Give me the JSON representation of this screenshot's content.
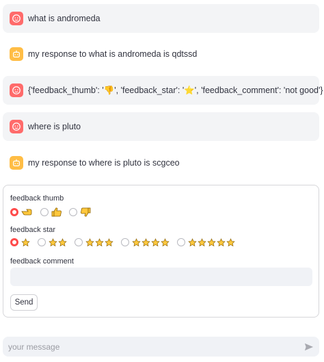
{
  "messages": [
    {
      "role": "user",
      "text": "what is andromeda"
    },
    {
      "role": "assistant",
      "text": "my response to what is andromeda is qdtssd"
    },
    {
      "role": "user",
      "text": "{'feedback_thumb': '👎', 'feedback_star': '⭐', 'feedback_comment': 'not good'}"
    },
    {
      "role": "user",
      "text": "where is pluto"
    },
    {
      "role": "assistant",
      "text": "my response to where is pluto is scgceo"
    }
  ],
  "feedback_form": {
    "thumb_label": "feedback thumb",
    "thumb_options": [
      "point-right-icon",
      "thumbs-up-icon",
      "thumbs-down-icon"
    ],
    "thumb_selected": 0,
    "star_label": "feedback star",
    "star_options": [
      1,
      2,
      3,
      4,
      5
    ],
    "star_selected": 0,
    "comment_label": "feedback comment",
    "comment_value": "",
    "send_label": "Send"
  },
  "chat_input": {
    "placeholder": "your message"
  },
  "colors": {
    "user_avatar": "#ff6b6b",
    "bot_avatar": "#ffbd45",
    "radio_selected": "#ff4b4b",
    "emoji_yellow": "#ffc83d"
  }
}
